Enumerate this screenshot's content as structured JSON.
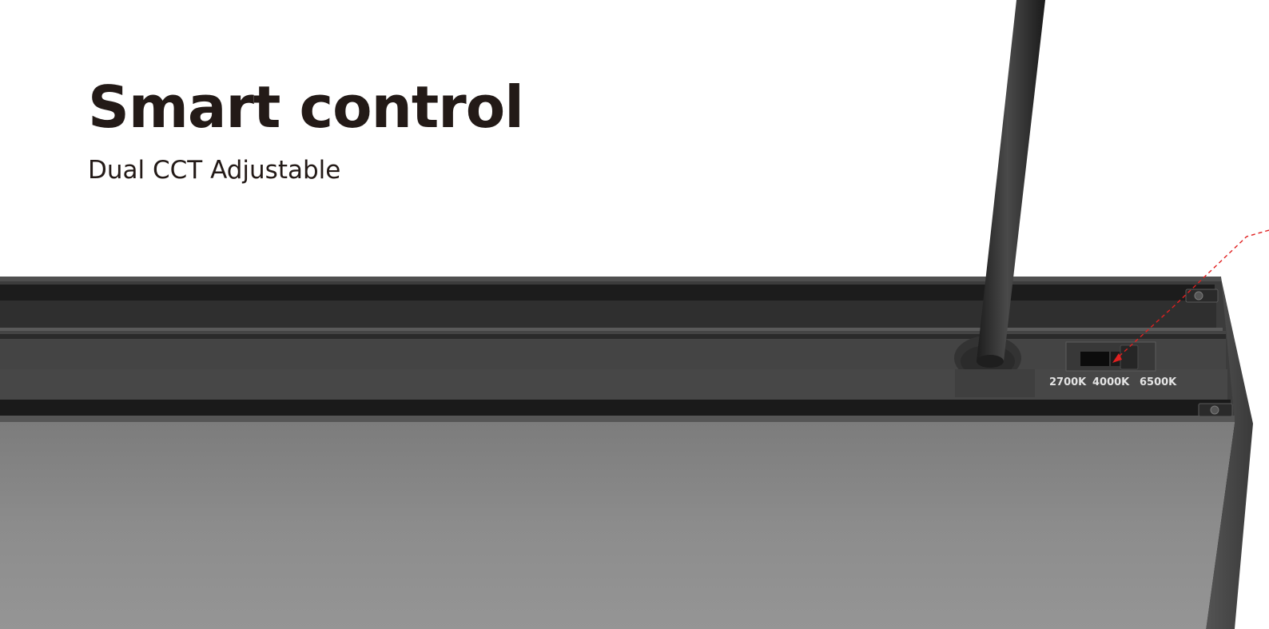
{
  "hero": {
    "title": "Smart control",
    "subtitle": "Dual CCT Adjustable"
  },
  "cct_switch": {
    "options": [
      "2700K",
      "4000K",
      "6500K"
    ],
    "selected": "4000K"
  },
  "colors": {
    "text": "#231a17",
    "fixture_body": "#8a8a8a",
    "fixture_top": "#3b3b3b",
    "callout": "#e02020"
  },
  "icons": [
    "suspension-cable-icon",
    "mounting-screw-icon",
    "callout-arrow-icon"
  ]
}
